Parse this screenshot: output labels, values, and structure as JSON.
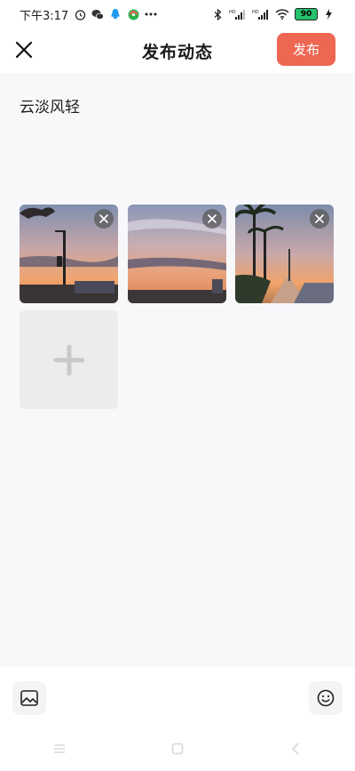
{
  "status_bar": {
    "time": "下午3:17",
    "battery": "90",
    "left_icons": [
      "alarm-icon",
      "wechat-icon",
      "qq-icon",
      "app-icon",
      "more-dots-icon"
    ],
    "right_icons": [
      "bluetooth-icon",
      "signal-hd-icon",
      "signal-hd-icon",
      "wifi-icon",
      "battery-icon",
      "charging-icon"
    ]
  },
  "header": {
    "title": "发布动态",
    "publish_label": "发布",
    "close_icon": "close-icon",
    "accent_color": "#ee6753"
  },
  "composer": {
    "text": "云淡风轻"
  },
  "photos": [
    {
      "name": "sunset-streetlamp-photo",
      "remove_icon": "close-icon"
    },
    {
      "name": "sunset-sky-photo",
      "remove_icon": "close-icon"
    },
    {
      "name": "sunset-palm-walkway-photo",
      "remove_icon": "close-icon"
    }
  ],
  "add_tile": {
    "icon": "plus-icon"
  },
  "toolbar": {
    "image_icon": "image-icon",
    "emoji_icon": "emoji-icon"
  },
  "nav": {
    "icons": [
      "menu-icon",
      "home-icon",
      "back-icon"
    ]
  }
}
